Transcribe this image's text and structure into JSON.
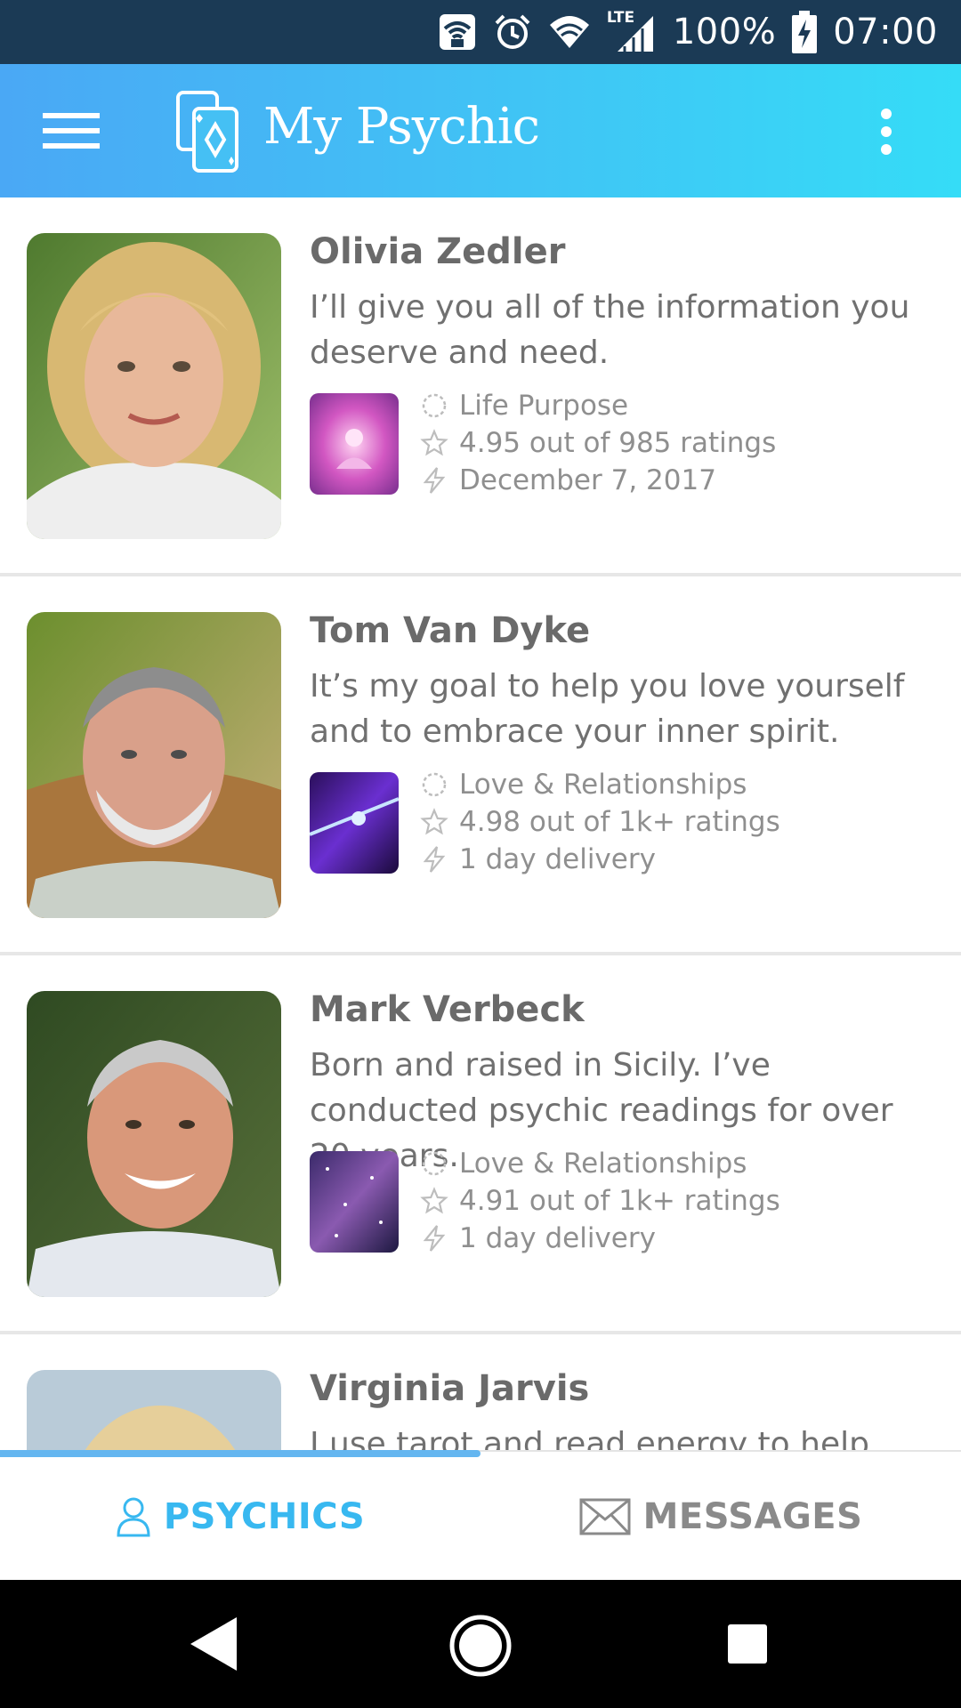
{
  "status_bar": {
    "battery": "100%",
    "time": "07:00",
    "network": "LTE",
    "icons": [
      "wifi-lock-icon",
      "alarm-icon",
      "wifi-icon",
      "signal-icon",
      "battery-charging-icon"
    ]
  },
  "app_bar": {
    "title": "My Psychic",
    "menu_icon": "hamburger-menu-icon",
    "logo_icon": "cards-logo-icon",
    "overflow_icon": "more-vertical-icon"
  },
  "psychics": [
    {
      "name": "Olivia Zedler",
      "bio": "I’ll give you all of the information you deserve and need.",
      "category": "Life Purpose",
      "rating": "4.95 out of 985 ratings",
      "delivery": "December 7, 2017"
    },
    {
      "name": "Tom Van Dyke",
      "bio": "It’s my goal to help you love yourself and to embrace your inner spirit.",
      "category": "Love & Relationships",
      "rating": "4.98 out of 1k+ ratings",
      "delivery": "1 day delivery"
    },
    {
      "name": "Mark Verbeck",
      "bio": "Born and raised in Sicily. I’ve conducted psychic readings for over 20 years.",
      "category": "Love & Relationships",
      "rating": "4.91 out of 1k+ ratings",
      "delivery": "1 day delivery"
    },
    {
      "name": "Virginia Jarvis",
      "bio": "I use tarot and read energy to help",
      "category": "",
      "rating": "",
      "delivery": ""
    }
  ],
  "tabs": {
    "psychics": "PSYCHICS",
    "messages": "MESSAGES",
    "active": "psychics"
  },
  "colors": {
    "status_bar": "#1b3a55",
    "app_bar_start": "#4aa8f5",
    "app_bar_end": "#35dcf7",
    "active_tab": "#38b8f0",
    "inactive_tab": "#8a8a8a"
  }
}
